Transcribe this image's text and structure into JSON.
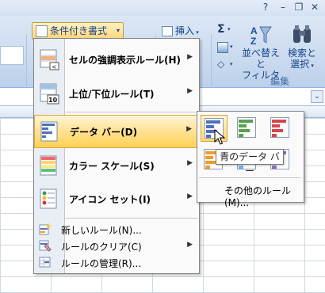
{
  "window": {
    "controls": {
      "help": "?",
      "minimize": "–",
      "restore": "❐",
      "close": "✕"
    }
  },
  "ribbon": {
    "conditional_formatting_label": "条件付き書式",
    "insert_label": "挿入",
    "sort_filter_label_1": "並べ替えと",
    "sort_filter_label_2": "フィルタ",
    "find_select_label_1": "検索と",
    "find_select_label_2": "選択",
    "editing_group_label": "編集"
  },
  "menu": {
    "items": [
      {
        "label": "セルの強調表示ルール(H)",
        "has_submenu": true
      },
      {
        "label": "上位/下位ルール(T)",
        "has_submenu": true
      },
      {
        "label": "データ バー(D)",
        "has_submenu": true,
        "selected": true
      },
      {
        "label": "カラー スケール(S)",
        "has_submenu": true
      },
      {
        "label": "アイコン セット(I)",
        "has_submenu": true
      }
    ],
    "small_items": [
      {
        "label": "新しいルール(N)...",
        "has_submenu": false
      },
      {
        "label": "ルールのクリア(C)",
        "has_submenu": true
      },
      {
        "label": "ルールの管理(R)...",
        "has_submenu": false
      }
    ],
    "top10_icon_text": "10"
  },
  "databar_submenu": {
    "tiles": [
      {
        "name": "blue",
        "color": "#4f6fc0",
        "hover": true
      },
      {
        "name": "green",
        "color": "#5aa04c"
      },
      {
        "name": "red",
        "color": "#d9434b"
      },
      {
        "name": "orange",
        "color": "#f39a2b"
      },
      {
        "name": "light-blue",
        "color": "#6fb1e6"
      },
      {
        "name": "purple",
        "color": "#8f6cbf"
      }
    ],
    "more_rules_label": "その他のルール(M)...",
    "tooltip": "青のデータ バー"
  },
  "colors": {
    "menu_highlight": "#ffd154",
    "ribbon_bg": "#c7d8ee",
    "grid_line": "#d0d7e5"
  }
}
